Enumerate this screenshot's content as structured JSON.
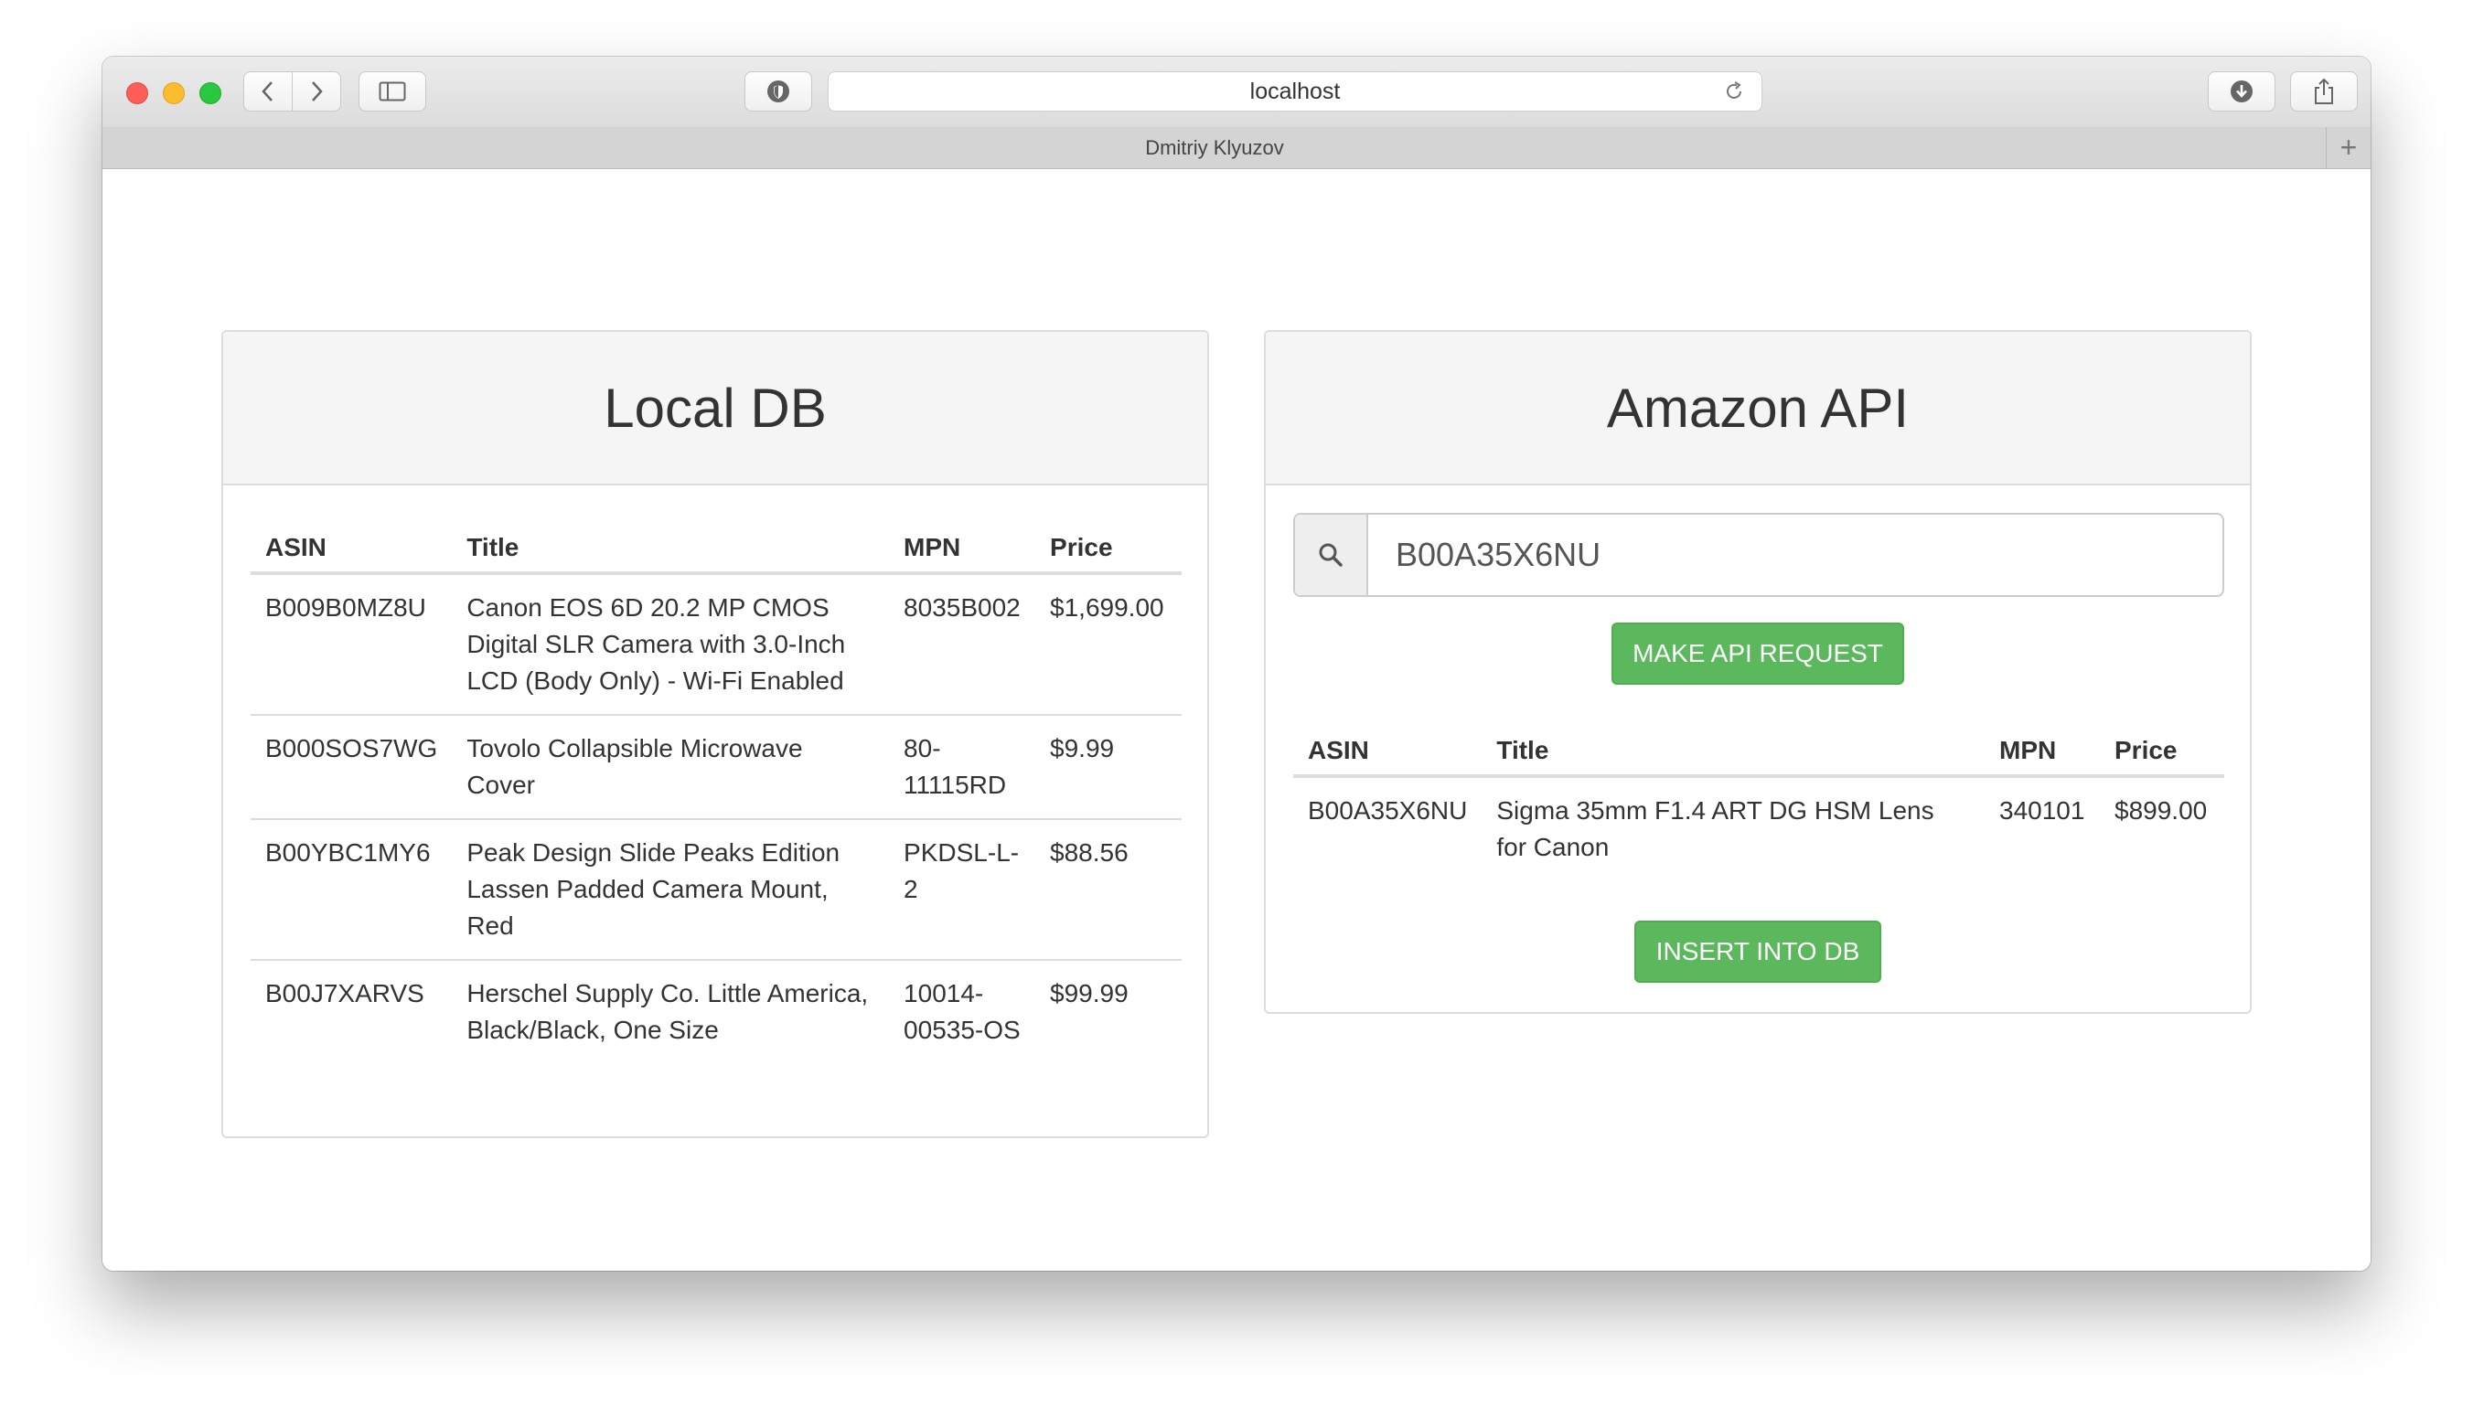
{
  "browser": {
    "url": "localhost",
    "tab_title": "Dmitriy Klyuzov",
    "new_tab_label": "+"
  },
  "local_db": {
    "heading": "Local DB",
    "columns": [
      "ASIN",
      "Title",
      "MPN",
      "Price"
    ],
    "rows": [
      {
        "asin": "B009B0MZ8U",
        "title": "Canon EOS 6D 20.2 MP CMOS Digital SLR Camera with 3.0-Inch LCD (Body Only) - Wi-Fi Enabled",
        "mpn": "8035B002",
        "price": "$1,699.00"
      },
      {
        "asin": "B000SOS7WG",
        "title": "Tovolo Collapsible Microwave Cover",
        "mpn": "80-11115RD",
        "price": "$9.99"
      },
      {
        "asin": "B00YBC1MY6",
        "title": "Peak Design Slide Peaks Edition Lassen Padded Camera Mount, Red",
        "mpn": "PKDSL-L-2",
        "price": "$88.56"
      },
      {
        "asin": "B00J7XARVS",
        "title": "Herschel Supply Co. Little America, Black/Black, One Size",
        "mpn": "10014-00535-OS",
        "price": "$99.99"
      }
    ]
  },
  "amazon_api": {
    "heading": "Amazon API",
    "search_value": "B00A35X6NU",
    "search_icon": "search-icon",
    "request_button_label": "MAKE API REQUEST",
    "insert_button_label": "INSERT INTO DB",
    "columns": [
      "ASIN",
      "Title",
      "MPN",
      "Price"
    ],
    "rows": [
      {
        "asin": "B00A35X6NU",
        "title": "Sigma 35mm F1.4 ART DG HSM Lens for Canon",
        "mpn": "340101",
        "price": "$899.00"
      }
    ]
  },
  "colors": {
    "success": "#5cb85c",
    "panel_heading_bg": "#f5f5f5",
    "border": "#dddddd"
  }
}
